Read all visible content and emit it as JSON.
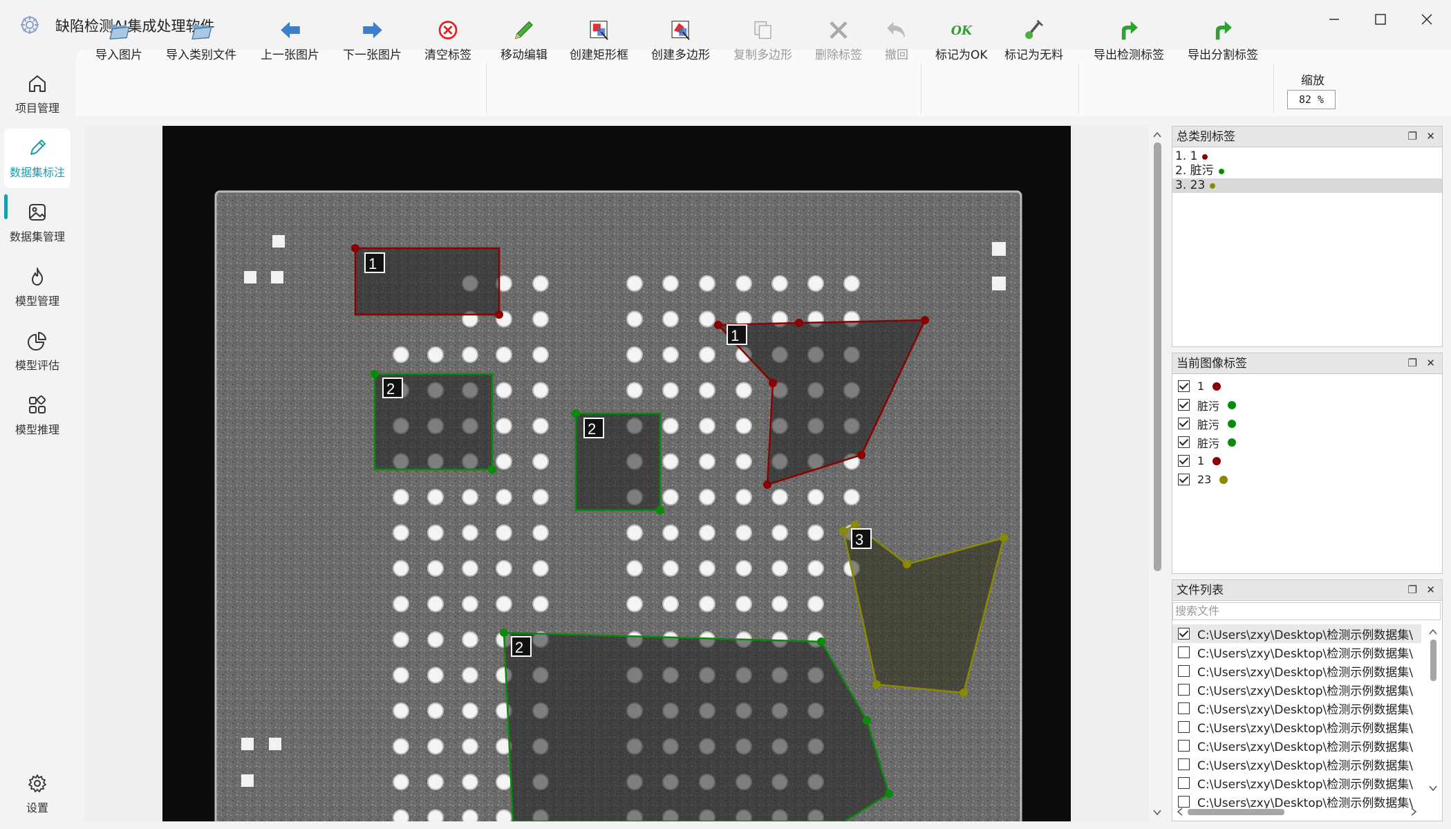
{
  "app": {
    "title": "缺陷检测AI集成处理软件"
  },
  "sidebar": {
    "items": [
      {
        "label": "项目管理",
        "icon": "home-icon"
      },
      {
        "label": "数据集标注",
        "icon": "pencil-icon"
      },
      {
        "label": "数据集管理",
        "icon": "image-icon"
      },
      {
        "label": "模型管理",
        "icon": "flame-icon"
      },
      {
        "label": "模型评估",
        "icon": "pie-chart-icon"
      },
      {
        "label": "模型推理",
        "icon": "apps-icon"
      }
    ],
    "settings": {
      "label": "设置",
      "icon": "gear-icon"
    },
    "active_index": 1
  },
  "toolbar": {
    "buttons": [
      {
        "label": "导入图片",
        "icon": "open-folder-icon",
        "enabled": true
      },
      {
        "label": "导入类别文件",
        "icon": "open-folder-icon",
        "enabled": true
      },
      {
        "label": "上一张图片",
        "icon": "arrow-left-icon",
        "enabled": true
      },
      {
        "label": "下一张图片",
        "icon": "arrow-right-icon",
        "enabled": true
      },
      {
        "label": "清空标签",
        "icon": "clear-icon",
        "enabled": true
      },
      {
        "label": "移动编辑",
        "icon": "pencil-icon",
        "enabled": true
      },
      {
        "label": "创建矩形框",
        "icon": "rectangle-icon",
        "enabled": true
      },
      {
        "label": "创建多边形",
        "icon": "polygon-icon",
        "enabled": true
      },
      {
        "label": "复制多边形",
        "icon": "copy-icon",
        "enabled": false
      },
      {
        "label": "删除标签",
        "icon": "delete-icon",
        "enabled": false
      },
      {
        "label": "撤回",
        "icon": "undo-icon",
        "enabled": false
      },
      {
        "label": "标记为OK",
        "icon": "ok-icon",
        "enabled": true
      },
      {
        "label": "标记为无料",
        "icon": "empty-mark-icon",
        "enabled": true
      },
      {
        "label": "导出检测标签",
        "icon": "export-icon",
        "enabled": true
      },
      {
        "label": "导出分割标签",
        "icon": "export-icon",
        "enabled": true
      }
    ],
    "zoom_label": "缩放",
    "zoom_value": "82 %"
  },
  "canvas": {
    "annotations": [
      {
        "label": "1",
        "color": "#8b0000"
      },
      {
        "label": "2",
        "color": "#0a8a0a"
      },
      {
        "label": "2",
        "color": "#0a8a0a"
      },
      {
        "label": "1",
        "color": "#8b0000"
      },
      {
        "label": "3",
        "color": "#8a8a00"
      },
      {
        "label": "2",
        "color": "#0a8a0a"
      }
    ]
  },
  "panels": {
    "categories": {
      "title": "总类别标签",
      "items": [
        {
          "text": "1. 1",
          "color": "#8b0000",
          "selected": false
        },
        {
          "text": "2. 脏污",
          "color": "#0a8a0a",
          "selected": false
        },
        {
          "text": "3. 23",
          "color": "#8a8a00",
          "selected": true
        }
      ]
    },
    "image_labels": {
      "title": "当前图像标签",
      "items": [
        {
          "text": "1",
          "color": "#8b0000",
          "checked": true
        },
        {
          "text": "脏污",
          "color": "#0a8a0a",
          "checked": true
        },
        {
          "text": "脏污",
          "color": "#0a8a0a",
          "checked": true
        },
        {
          "text": "脏污",
          "color": "#0a8a0a",
          "checked": true
        },
        {
          "text": "1",
          "color": "#8b0000",
          "checked": true
        },
        {
          "text": "23",
          "color": "#8a8a00",
          "checked": true
        }
      ]
    },
    "files": {
      "title": "文件列表",
      "search_placeholder": "搜索文件",
      "items": [
        {
          "path": "C:\\Users\\zxy\\Desktop\\检测示例数据集\\",
          "checked": true
        },
        {
          "path": "C:\\Users\\zxy\\Desktop\\检测示例数据集\\",
          "checked": false
        },
        {
          "path": "C:\\Users\\zxy\\Desktop\\检测示例数据集\\",
          "checked": false
        },
        {
          "path": "C:\\Users\\zxy\\Desktop\\检测示例数据集\\",
          "checked": false
        },
        {
          "path": "C:\\Users\\zxy\\Desktop\\检测示例数据集\\",
          "checked": false
        },
        {
          "path": "C:\\Users\\zxy\\Desktop\\检测示例数据集\\",
          "checked": false
        },
        {
          "path": "C:\\Users\\zxy\\Desktop\\检测示例数据集\\",
          "checked": false
        },
        {
          "path": "C:\\Users\\zxy\\Desktop\\检测示例数据集\\",
          "checked": false
        },
        {
          "path": "C:\\Users\\zxy\\Desktop\\检测示例数据集\\",
          "checked": false
        },
        {
          "path": "C:\\Users\\zxy\\Desktop\\检测示例数据集\\",
          "checked": false
        }
      ]
    }
  }
}
